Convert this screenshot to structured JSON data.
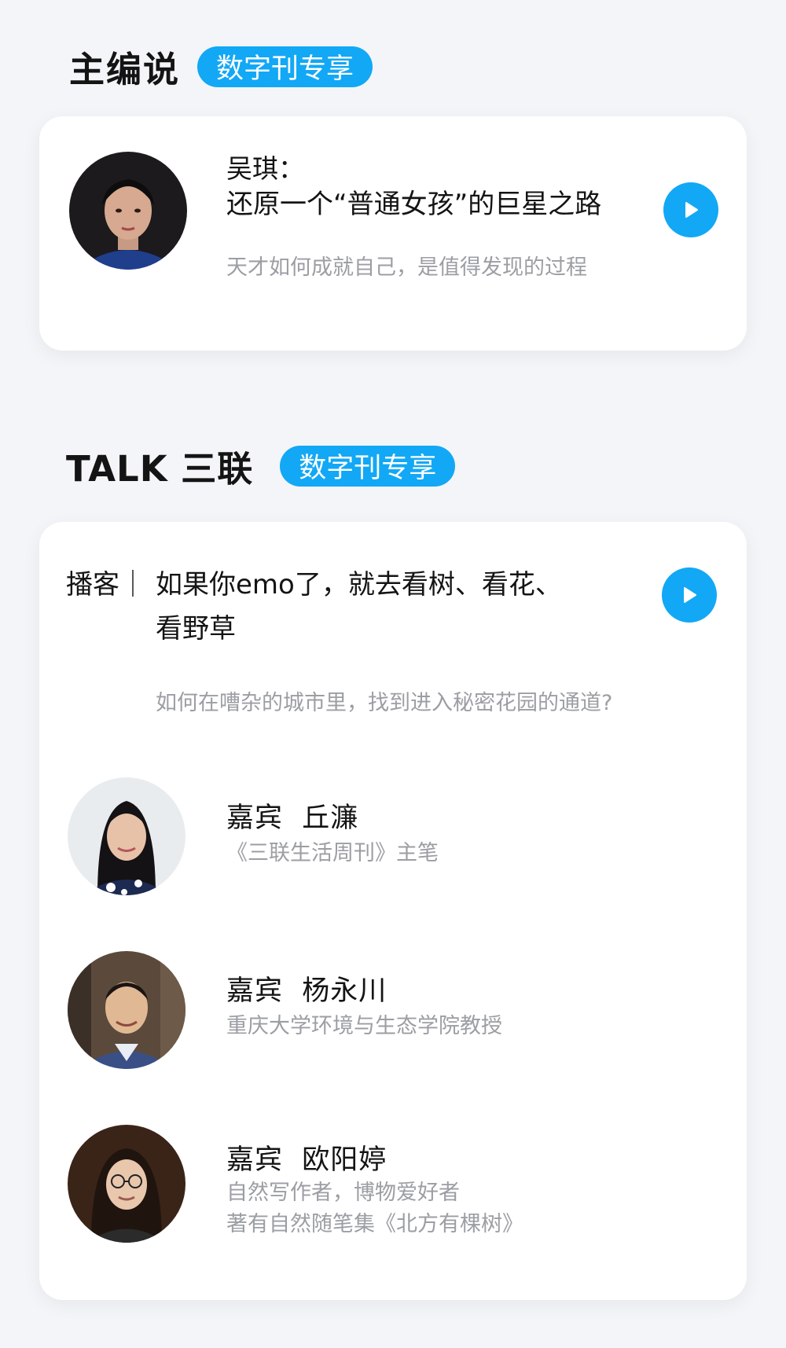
{
  "editor": {
    "section_title": "主编说",
    "badge": "数字刊专享",
    "name": "吴琪：",
    "title": "还原一个“普通女孩”的巨星之路",
    "subtitle": "天才如何成就自己，是值得发现的过程",
    "play_icon": "play-icon"
  },
  "talk": {
    "section_title": "TALK 三联",
    "badge": "数字刊专享",
    "category": "播客｜",
    "title_line1": "如果你emo了，就去看树、看花、",
    "title_line2": "看野草",
    "subtitle": "如何在嘈杂的城市里，找到进入秘密花园的通道?",
    "guests": [
      {
        "label": "嘉宾",
        "name": "丘濂",
        "desc": [
          "《三联生活周刊》主笔"
        ]
      },
      {
        "label": "嘉宾",
        "name": "杨永川",
        "desc": [
          "重庆大学环境与生态学院教授"
        ]
      },
      {
        "label": "嘉宾",
        "name": "欧阳婷",
        "desc": [
          "自然写作者，博物爱好者",
          "著有自然随笔集《北方有棵树》"
        ]
      }
    ]
  },
  "colors": {
    "accent": "#12a8f5",
    "background": "#f3f5f9",
    "muted": "#9b9ea3"
  }
}
